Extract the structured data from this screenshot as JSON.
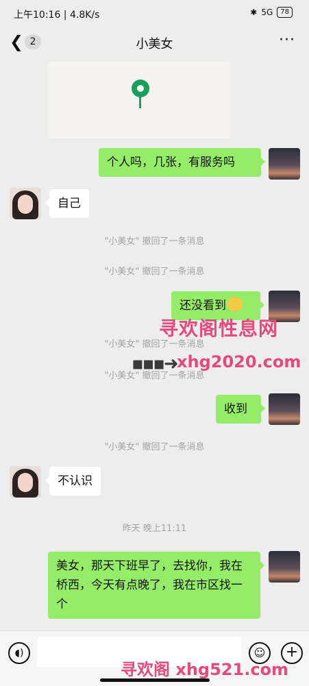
{
  "status_bar": {
    "time_speed": "上午10:16 | 4.8K/s",
    "network": "5G",
    "battery": "78"
  },
  "header": {
    "back_badge": "2",
    "title": "小美女",
    "more": "···"
  },
  "messages": {
    "m1": "个人吗，几张，有服务吗",
    "m2": "自己",
    "sys1": "\"小美女\" 撤回了一条消息",
    "sys2": "\"小美女\" 撤回了一条消息",
    "m3": "还没看到",
    "sys3": "\"小美女\" 撤回了一条消息",
    "sys4": "\"小美女\" 撤回了一条消息",
    "m4": "收到",
    "sys5": "\"小美女\" 撤回了一条消息",
    "m5": "不认识",
    "time_divider": "昨天 晚上11:11",
    "m6": "美女，那天下班早了，去找你，我在桥西，今天有点晚了，我在市区找一个"
  },
  "watermarks": {
    "w1": "寻欢阁性息网",
    "w2": "xhg2020.com",
    "w3": "寻欢阁 xhg521.com"
  },
  "colors": {
    "bubble_out": "#95ec69",
    "bubble_in": "#ffffff",
    "bg": "#ededed"
  }
}
